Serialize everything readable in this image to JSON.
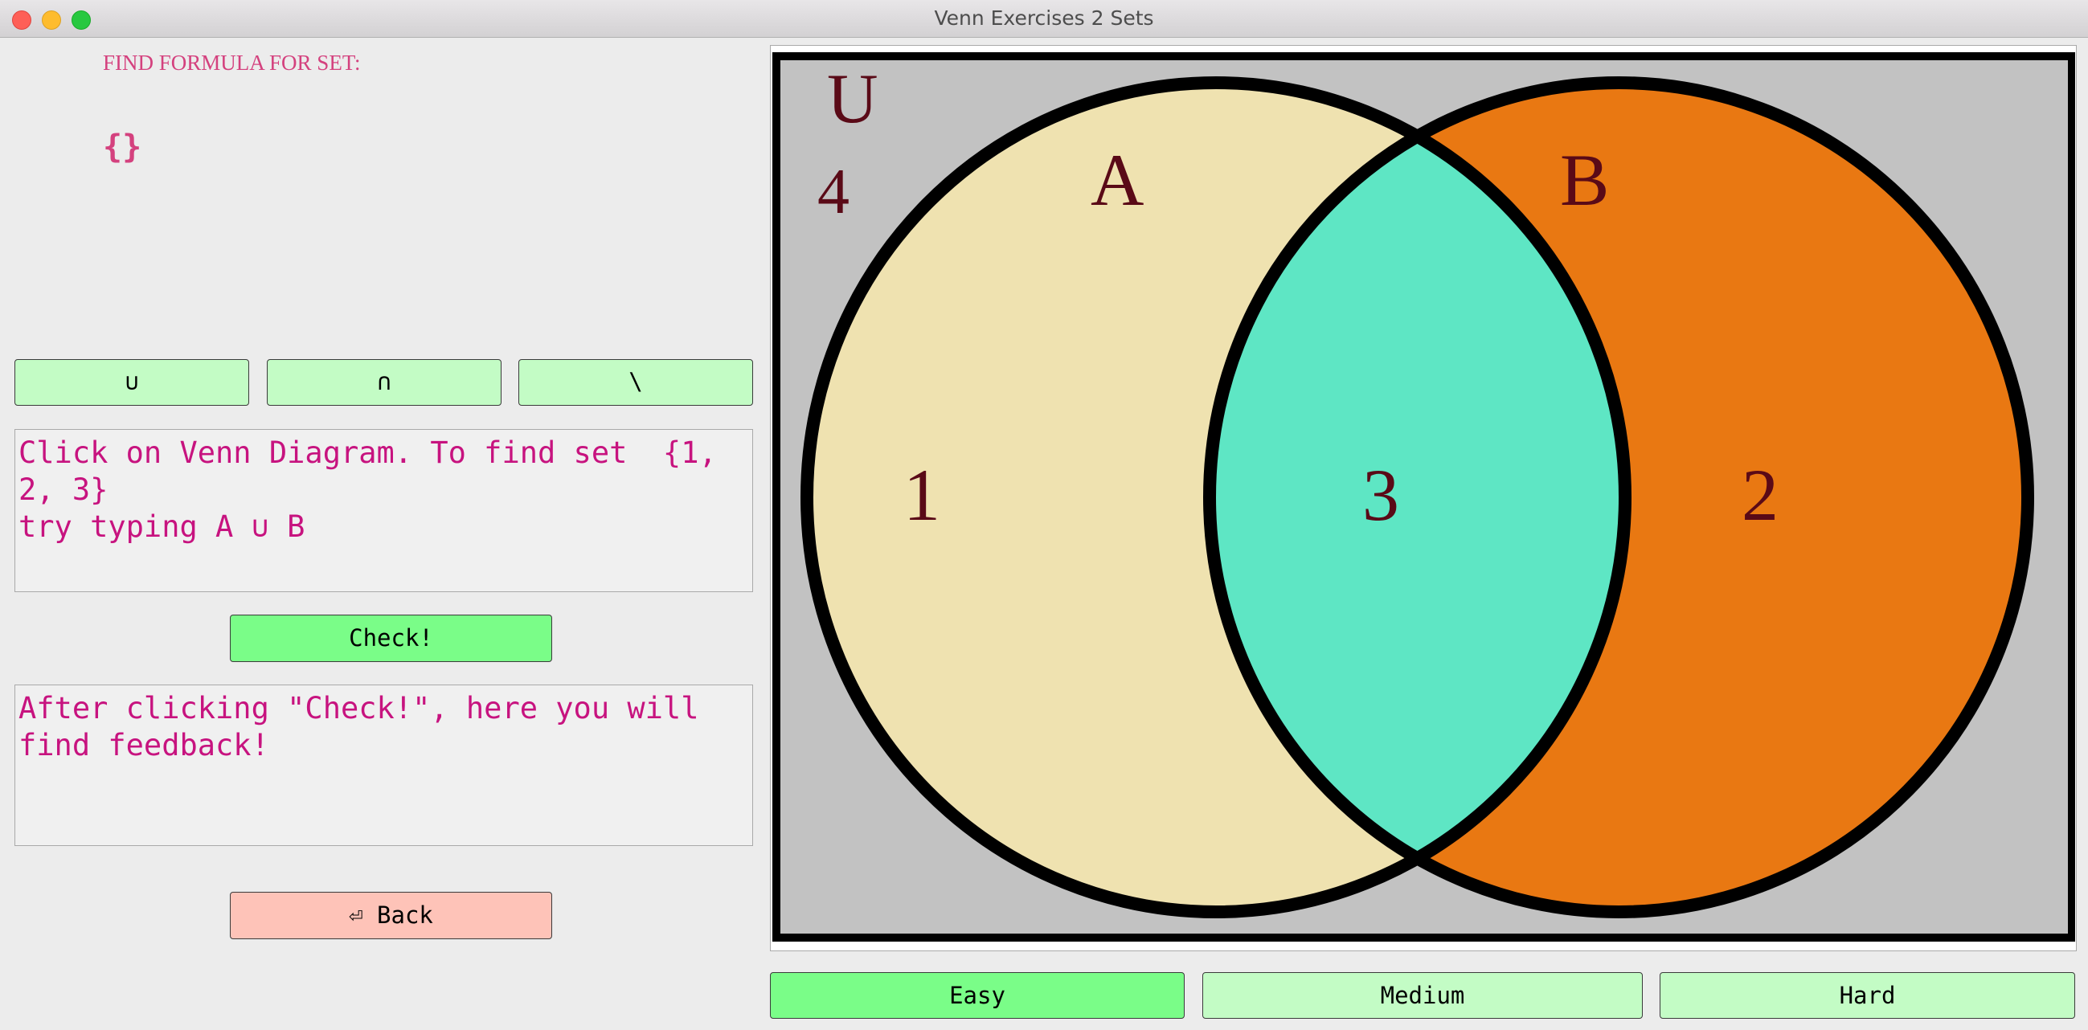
{
  "window": {
    "title": "Venn Exercises 2 Sets"
  },
  "prompt": {
    "label": "FIND FORMULA FOR SET:",
    "target_set": "{}"
  },
  "operators": {
    "union": "∪",
    "intersection": "∩",
    "difference": "\\"
  },
  "input": {
    "value": "Click on Venn Diagram. To find set  {1, 2, 3}\ntry typing A ∪ B"
  },
  "check_button": {
    "label": "Check!"
  },
  "feedback": {
    "value": "After clicking \"Check!\", here you will find feedback!"
  },
  "back_button": {
    "label": "⏎  Back"
  },
  "diagram": {
    "universe_label": "U",
    "universe_region_value": "4",
    "set_a_label": "A",
    "set_b_label": "B",
    "region_a_only": "1",
    "region_b_only": "2",
    "region_a_and_b": "3",
    "colors": {
      "background": "#c2c2c2",
      "a_only": "#efe2b0",
      "b_only": "#e97812",
      "intersection": "#5ee6c4",
      "outline": "#000000",
      "label": "#5a0a17"
    }
  },
  "difficulty": {
    "easy": "Easy",
    "medium": "Medium",
    "hard": "Hard",
    "selected": "Easy"
  }
}
